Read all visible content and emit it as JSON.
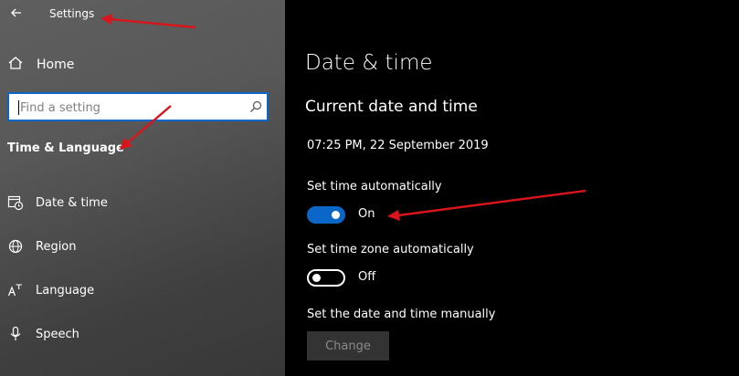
{
  "window": {
    "title": "Settings"
  },
  "sidebar": {
    "home_label": "Home",
    "search": {
      "placeholder": "Find a setting"
    },
    "section_title": "Time & Language",
    "items": [
      {
        "label": "Date & time",
        "icon": "date-time-icon"
      },
      {
        "label": "Region",
        "icon": "globe-icon"
      },
      {
        "label": "Language",
        "icon": "language-icon"
      },
      {
        "label": "Speech",
        "icon": "microphone-icon"
      }
    ]
  },
  "main": {
    "title": "Date & time",
    "subtitle": "Current date and time",
    "current_datetime": "07:25 PM, 22 September 2019",
    "auto_time": {
      "label": "Set time automatically",
      "state": "On"
    },
    "auto_timezone": {
      "label": "Set time zone automatically",
      "state": "Off"
    },
    "manual": {
      "label": "Set the date and time manually",
      "button": "Change"
    }
  },
  "colors": {
    "accent": "#0a67c7",
    "annotation_arrow": "#d9151b",
    "sidebar_bg": "#5a5a5a",
    "main_bg": "#000000",
    "disabled_button_bg": "#333333"
  }
}
